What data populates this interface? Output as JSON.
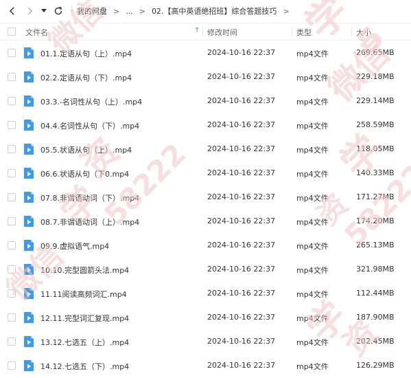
{
  "nav": {
    "back_icon": "chevron-left-icon",
    "forward_icon": "chevron-right-icon",
    "history_icon": "dropdown-caret-icon",
    "refresh_icon": "refresh-icon"
  },
  "breadcrumb": {
    "root": "我的网盘",
    "ellipsis": "...",
    "current": "02.【高中英语绝招班】综合答题技巧"
  },
  "header": {
    "name": "文件名",
    "date": "修改时间",
    "type": "类型",
    "size": "大小"
  },
  "files": [
    {
      "name": "01.1.定语从句（上）.mp4",
      "date": "2024-10-16 22:37",
      "type": "mp4文件",
      "size": "269.65MB"
    },
    {
      "name": "02.2.定语从句（下）.mp4",
      "date": "2024-10-16 22:37",
      "type": "mp4文件",
      "size": "229.18MB"
    },
    {
      "name": "03.3.-名词性从句（上）.mp4",
      "date": "2024-10-16 22:37",
      "type": "mp4文件",
      "size": "229.14MB"
    },
    {
      "name": "04.4.名词性从句（下）.mp4",
      "date": "2024-10-16 22:37",
      "type": "mp4文件",
      "size": "258.59MB"
    },
    {
      "name": "05.5.状语从句（上）.mp4",
      "date": "2024-10-16 22:37",
      "type": "mp4文件",
      "size": "118.05MB"
    },
    {
      "name": "06.6.状语从句（下0.mp4",
      "date": "2024-10-16 22:37",
      "type": "mp4文件",
      "size": "140.33MB"
    },
    {
      "name": "07.8.非谓语动词（下）.mp4",
      "date": "2024-10-16 22:37",
      "type": "mp4文件",
      "size": "171.27MB"
    },
    {
      "name": "08.7.非谓语动词（上）.mp4",
      "date": "2024-10-16 22:37",
      "type": "mp4文件",
      "size": "174.20MB"
    },
    {
      "name": "09.9.虚拟语气.mp4",
      "date": "2024-10-16 22:37",
      "type": "mp4文件",
      "size": "265.13MB"
    },
    {
      "name": "10.10.完型圆箭头法.mp4",
      "date": "2024-10-16 22:37",
      "type": "mp4文件",
      "size": "321.98MB"
    },
    {
      "name": "11.11阅读高频词汇.mp4",
      "date": "2024-10-16 22:37",
      "type": "mp4文件",
      "size": "112.44MB"
    },
    {
      "name": "12.11.完型词汇复现.mp4",
      "date": "2024-10-16 22:37",
      "type": "mp4文件",
      "size": "187.90MB"
    },
    {
      "name": "13.12.七选五（上）.mp4",
      "date": "2024-10-16 22:37",
      "type": "mp4文件",
      "size": "202.45MB"
    },
    {
      "name": "14.12.七选五（下）.mp4",
      "date": "2024-10-16 22:37",
      "type": "mp4文件",
      "size": "126.29MB"
    }
  ],
  "colors": {
    "accent": "#2f8ce6",
    "file_icon": "#3a9bf0",
    "watermark": "#f3c9c9"
  }
}
